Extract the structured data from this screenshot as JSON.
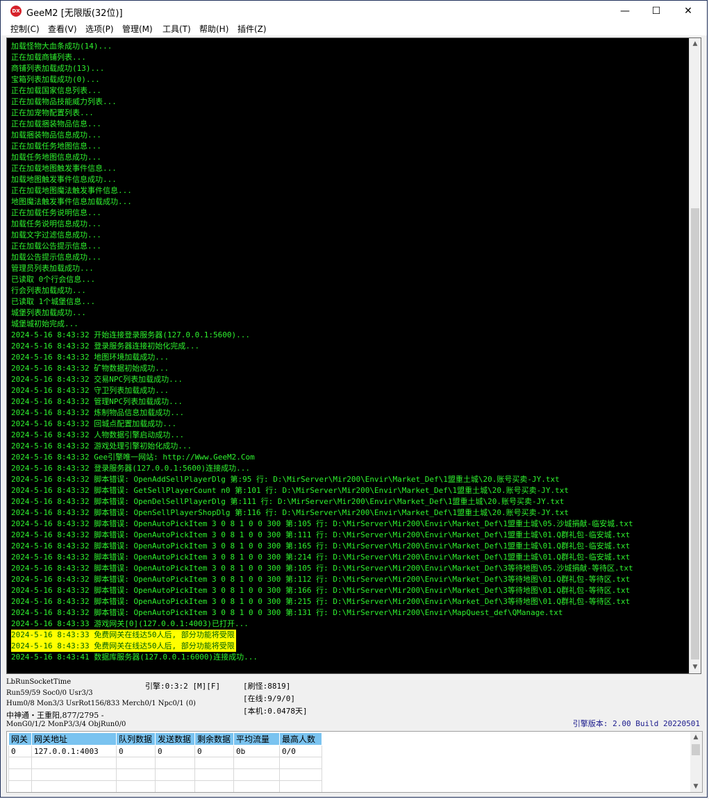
{
  "window": {
    "title": "GeeM2 [无限版(32位)]",
    "app_icon_text": "DX"
  },
  "window_controls": {
    "minimize": "—",
    "maximize": "☐",
    "close": "✕"
  },
  "menu": [
    "控制(C)",
    "查看(V)",
    "选项(P)",
    "管理(M)",
    "工具(T)",
    "帮助(H)",
    "插件(Z)"
  ],
  "log": {
    "lines": [
      {
        "text": "加载怪物大血条成功(14)...",
        "highlight": false
      },
      {
        "text": "正在加载商铺列表...",
        "highlight": false
      },
      {
        "text": "商铺列表加载成功(13)...",
        "highlight": false
      },
      {
        "text": "宝箱列表加载成功(0)...",
        "highlight": false
      },
      {
        "text": "正在加载国家信息列表...",
        "highlight": false
      },
      {
        "text": "正在加载物品技能威力列表...",
        "highlight": false
      },
      {
        "text": "正在加宠物配置列表...",
        "highlight": false
      },
      {
        "text": "正在加载捆装物品信息...",
        "highlight": false
      },
      {
        "text": "加载捆装物品信息成功...",
        "highlight": false
      },
      {
        "text": "正在加载任务地图信息...",
        "highlight": false
      },
      {
        "text": "加载任务地图信息成功...",
        "highlight": false
      },
      {
        "text": "正在加载地图触发事件信息...",
        "highlight": false
      },
      {
        "text": "加载地图触发事件信息成功...",
        "highlight": false
      },
      {
        "text": "正在加载地图魔法触发事件信息...",
        "highlight": false
      },
      {
        "text": "地图魔法触发事件信息加载成功...",
        "highlight": false
      },
      {
        "text": "正在加载任务说明信息...",
        "highlight": false
      },
      {
        "text": "加载任务说明信息成功...",
        "highlight": false
      },
      {
        "text": "加载文字过滤信息成功...",
        "highlight": false
      },
      {
        "text": "正在加载公告提示信息...",
        "highlight": false
      },
      {
        "text": "加载公告提示信息成功...",
        "highlight": false
      },
      {
        "text": "管理员列表加载成功...",
        "highlight": false
      },
      {
        "text": "已读取 0个行会信息...",
        "highlight": false
      },
      {
        "text": "行会列表加载成功...",
        "highlight": false
      },
      {
        "text": "已读取 1个城堡信息...",
        "highlight": false
      },
      {
        "text": "城堡列表加载成功...",
        "highlight": false
      },
      {
        "text": "城堡城初始完成...",
        "highlight": false
      },
      {
        "text": "2024-5-16 8:43:32 开始连接登录服务器(127.0.0.1:5600)...",
        "highlight": false
      },
      {
        "text": "2024-5-16 8:43:32 登录服务器连接初始化完成...",
        "highlight": false
      },
      {
        "text": "2024-5-16 8:43:32 地图环境加载成功...",
        "highlight": false
      },
      {
        "text": "2024-5-16 8:43:32 矿物数据初始成功...",
        "highlight": false
      },
      {
        "text": "2024-5-16 8:43:32 交易NPC列表加载成功...",
        "highlight": false
      },
      {
        "text": "2024-5-16 8:43:32 守卫列表加载成功...",
        "highlight": false
      },
      {
        "text": "2024-5-16 8:43:32 管理NPC列表加载成功...",
        "highlight": false
      },
      {
        "text": "2024-5-16 8:43:32 炼制物品信息加载成功...",
        "highlight": false
      },
      {
        "text": "2024-5-16 8:43:32 回城点配置加载成功...",
        "highlight": false
      },
      {
        "text": "2024-5-16 8:43:32 人物数据引擎启动成功...",
        "highlight": false
      },
      {
        "text": "2024-5-16 8:43:32 游戏处理引擎初始化成功...",
        "highlight": false
      },
      {
        "text": "2024-5-16 8:43:32 Gee引擎唯一网站: http://Www.GeeM2.Com",
        "highlight": false
      },
      {
        "text": "2024-5-16 8:43:32 登录服务器(127.0.0.1:5600)连接成功...",
        "highlight": false
      },
      {
        "text": "2024-5-16 8:43:32 脚本错误: OpenAddSellPlayerDlg 第:95 行: D:\\MirServer\\Mir200\\Envir\\Market_Def\\1盟重土城\\20.账号买卖-JY.txt",
        "highlight": false
      },
      {
        "text": "2024-5-16 8:43:32 脚本错误: GetSellPlayerCount n0 第:101 行: D:\\MirServer\\Mir200\\Envir\\Market_Def\\1盟重土城\\20.账号买卖-JY.txt",
        "highlight": false
      },
      {
        "text": "2024-5-16 8:43:32 脚本错误: OpenDelSellPlayerDlg 第:111 行: D:\\MirServer\\Mir200\\Envir\\Market_Def\\1盟重土城\\20.账号买卖-JY.txt",
        "highlight": false
      },
      {
        "text": "2024-5-16 8:43:32 脚本错误: OpenSellPlayerShopDlg 第:116 行: D:\\MirServer\\Mir200\\Envir\\Market_Def\\1盟重土城\\20.账号买卖-JY.txt",
        "highlight": false
      },
      {
        "text": "2024-5-16 8:43:32 脚本错误: OpenAutoPickItem 3 0 8 1 0 0 300 第:105 行: D:\\MirServer\\Mir200\\Envir\\Market_Def\\1盟重土城\\05.沙城捐献-临安城.txt",
        "highlight": false
      },
      {
        "text": "2024-5-16 8:43:32 脚本错误: OpenAutoPickItem 3 0 8 1 0 0 300 第:111 行: D:\\MirServer\\Mir200\\Envir\\Market_Def\\1盟重土城\\01.Q群礼包-临安城.txt",
        "highlight": false
      },
      {
        "text": "2024-5-16 8:43:32 脚本错误: OpenAutoPickItem 3 0 8 1 0 0 300 第:165 行: D:\\MirServer\\Mir200\\Envir\\Market_Def\\1盟重土城\\01.Q群礼包-临安城.txt",
        "highlight": false
      },
      {
        "text": "2024-5-16 8:43:32 脚本错误: OpenAutoPickItem 3 0 8 1 0 0 300 第:214 行: D:\\MirServer\\Mir200\\Envir\\Market_Def\\1盟重土城\\01.Q群礼包-临安城.txt",
        "highlight": false
      },
      {
        "text": "2024-5-16 8:43:32 脚本错误: OpenAutoPickItem 3 0 8 1 0 0 300 第:105 行: D:\\MirServer\\Mir200\\Envir\\Market_Def\\3等待地图\\05.沙城捐献-等待区.txt",
        "highlight": false
      },
      {
        "text": "2024-5-16 8:43:32 脚本错误: OpenAutoPickItem 3 0 8 1 0 0 300 第:112 行: D:\\MirServer\\Mir200\\Envir\\Market_Def\\3等待地图\\01.Q群礼包-等待区.txt",
        "highlight": false
      },
      {
        "text": "2024-5-16 8:43:32 脚本错误: OpenAutoPickItem 3 0 8 1 0 0 300 第:166 行: D:\\MirServer\\Mir200\\Envir\\Market_Def\\3等待地图\\01.Q群礼包-等待区.txt",
        "highlight": false
      },
      {
        "text": "2024-5-16 8:43:32 脚本错误: OpenAutoPickItem 3 0 8 1 0 0 300 第:215 行: D:\\MirServer\\Mir200\\Envir\\Market_Def\\3等待地图\\01.Q群礼包-等待区.txt",
        "highlight": false
      },
      {
        "text": "2024-5-16 8:43:32 脚本错误: OpenAutoPickItem 3 0 8 1 0 0 300 第:131 行: D:\\MirServer\\Mir200\\Envir\\MapQuest_def\\QManage.txt",
        "highlight": false
      },
      {
        "text": "2024-5-16 8:43:33 游戏网关[0](127.0.0.1:4003)已打开...",
        "highlight": false
      },
      {
        "text": "2024-5-16 8:43:33 免费网关在线达50人后, 部分功能将受限",
        "highlight": true
      },
      {
        "text": "2024-5-16 8:43:33 免费网关在线达50人后, 部分功能将受限",
        "highlight": true
      },
      {
        "text": "2024-5-16 8:43:41 数据库服务器(127.0.0.1:6000)连接成功...",
        "highlight": false
      }
    ]
  },
  "status": {
    "socket_time": "LbRunSocketTime",
    "run": "Run59/59 Soc0/0 Usr3/3",
    "hum": "Hum0/8 Mon3/3 UsrRot156/833 Merch0/1 Npc0/1 (0)",
    "player": "中神通・王重阳,877/2795 -",
    "mon": "MonG0/1/2 MonP3/3/4 ObjRun0/0",
    "engine": "引擎:0:3:2 [M][F]",
    "refresh": "[刷怪:8819]",
    "online": "[在线:9/9/0]",
    "local": "[本机:0.0478天]",
    "engine_version": "引擎版本: 2.00 Build 20220501"
  },
  "gateway_table": {
    "headers": [
      "网关",
      "网关地址",
      "队列数据",
      "发送数据",
      "剩余数据",
      "平均流量",
      "最高人数"
    ],
    "rows": [
      [
        "0",
        "127.0.0.1:4003",
        "0",
        "0",
        "0",
        "0b",
        "0/0"
      ]
    ]
  },
  "colors": {
    "log_bg": "#000000",
    "log_text": "#2ef22e",
    "highlight_bg": "#ffff00",
    "header_bg": "#7ac3f0"
  }
}
